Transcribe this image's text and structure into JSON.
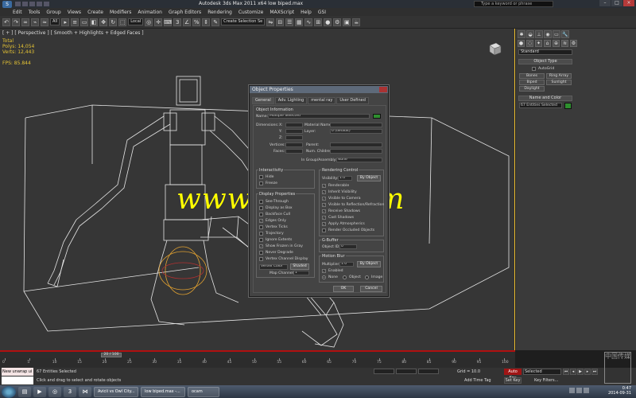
{
  "window": {
    "title": "Autodesk 3ds Max  2011 x64    low biped.max",
    "search_placeholder": "Type a keyword or phrase",
    "logo_letter": "S"
  },
  "menu": [
    "Edit",
    "Tools",
    "Group",
    "Views",
    "Create",
    "Modifiers",
    "Animation",
    "Graph Editors",
    "Rendering",
    "Customize",
    "MAXScript",
    "Help",
    "GSI"
  ],
  "toolbar": {
    "all_filter": "All",
    "view_dd": "Local",
    "selection_set": "Create Selection Se"
  },
  "viewport": {
    "label": "[ + ] [ Perspective ] [ Smooth + Highlights + Edged Faces ]",
    "stats_total": "Total",
    "polys": "Polys:   14,054",
    "verts": "Verts:   12,443",
    "fps": "FPS:     85.844"
  },
  "watermark": "www.cgtsj.com",
  "dialog": {
    "title": "Object Properties",
    "tabs": [
      "General",
      "Adv. Lighting",
      "mental ray",
      "User Defined"
    ],
    "info_group": "Object Information",
    "name_label": "Name:",
    "name_value": "Multiple Selected",
    "dimensions_label": "Dimensions:",
    "x_label": "X:",
    "y_label": "Y:",
    "z_label": "Z:",
    "material_label": "Material Name:",
    "layer_label": "Layer:",
    "layer_value": "0 (default)",
    "vertices_label": "Vertices:",
    "faces_label": "Faces:",
    "parent_label": "Parent:",
    "num_children_label": "Num. Children:",
    "ingroup_label": "In Group/Assembly:",
    "ingroup_value": "None",
    "interactivity_group": "Interactivity",
    "hide": "Hide",
    "freeze": "Freeze",
    "display_group": "Display Properties",
    "see_through": "See-Through",
    "display_as_box": "Display as Box",
    "backface_cull": "Backface Cull",
    "edges_only": "Edges Only",
    "vertex_ticks": "Vertex Ticks",
    "trajectory": "Trajectory",
    "ignore_extents": "Ignore Extents",
    "show_frozen_gray": "Show Frozen in Gray",
    "never_degrade": "Never Degrade",
    "vertex_channel_display": "Vertex Channel Display",
    "vertex_color": "Vertex Color",
    "shaded": "Shaded",
    "map_channel": "Map Channel:",
    "map_channel_value": "1",
    "rendering_group": "Rendering Control",
    "visibility_label": "Visibility:",
    "visibility_value": "1.0",
    "by_object": "By Object",
    "renderable": "Renderable",
    "inherit_visibility": "Inherit Visibility",
    "visible_camera": "Visible to Camera",
    "visible_reflection": "Visible to Reflection/Refraction",
    "receive_shadows": "Receive Shadows",
    "cast_shadows": "Cast Shadows",
    "apply_atmospherics": "Apply Atmospherics",
    "render_occluded": "Render Occluded Objects",
    "gbuffer_group": "G-Buffer",
    "object_id_label": "Object ID:",
    "object_id_value": "0",
    "motion_blur_group": "Motion Blur",
    "multiplier_label": "Multiplier:",
    "multiplier_value": "1.0",
    "by_object_2": "By Object",
    "enabled": "Enabled",
    "none": "None",
    "object": "Object",
    "image": "Image",
    "ok": "OK",
    "cancel": "Cancel"
  },
  "command_panel": {
    "category": "Standard",
    "object_type_title": "Object Type",
    "autogrid": "AutoGrid",
    "buttons": [
      "Bones",
      "Ring Array",
      "Biped",
      "Sunlight",
      "Daylight"
    ],
    "name_color_title": "Name and Color",
    "entries_selected": "67 Entities Selected",
    "swatch_color": "#2e8f2e"
  },
  "timeline": {
    "frame_display": "20 / 100",
    "ticks": [
      "0",
      "5",
      "10",
      "15",
      "20",
      "25",
      "30",
      "35",
      "40",
      "45",
      "50",
      "55",
      "60",
      "65",
      "70",
      "75",
      "80",
      "85",
      "90",
      "95",
      "100"
    ]
  },
  "status": {
    "maxscript_value": "New unwrap ui",
    "selection": "67 Entities Selected",
    "prompt": "Click and drag to select and rotate objects",
    "grid": "Grid = 10.0",
    "add_time_tag": "Add Time Tag",
    "auto_key": "Auto Key",
    "set_key": "Set Key",
    "selected_dd": "Selected",
    "key_filters": "Key Filters..."
  },
  "taskbar": {
    "tasks": [
      "Avicii vs Owl City...",
      "low biped.max -...",
      "ocam"
    ],
    "time": "0:47",
    "date": "2014-09-31"
  },
  "stamp_text": "中国传媒"
}
